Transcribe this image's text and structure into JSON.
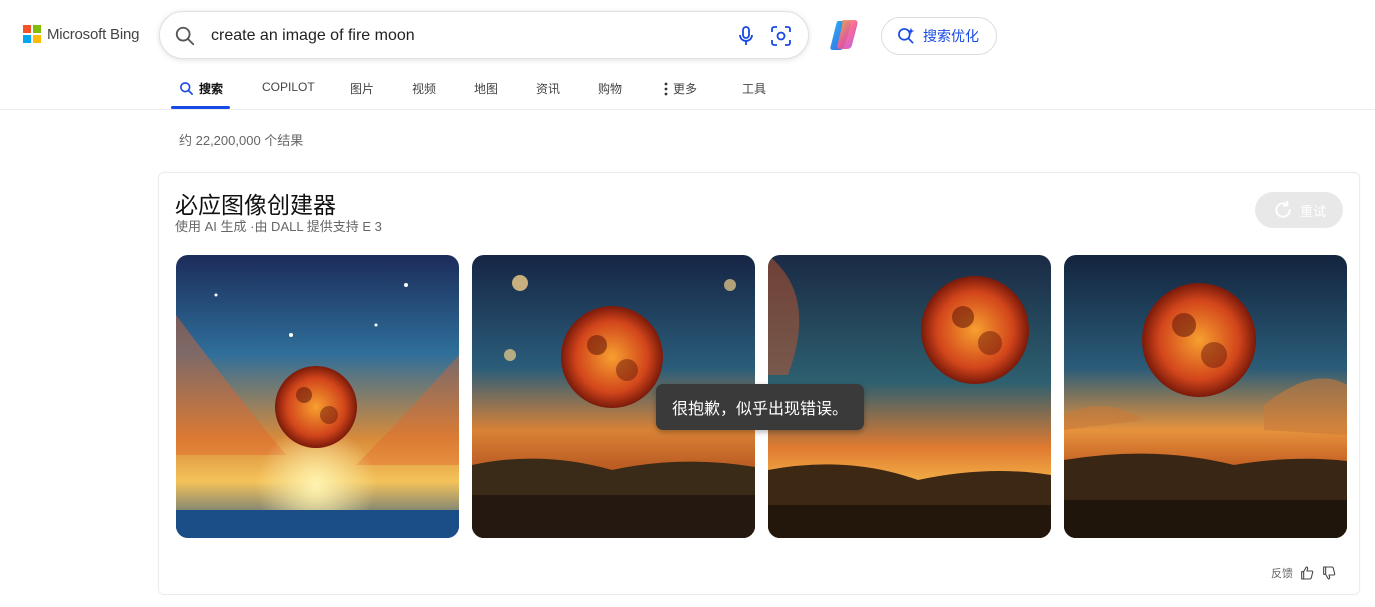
{
  "header": {
    "logo_text": "Microsoft Bing",
    "search": {
      "value": "create an image of fire moon"
    },
    "optimize_label": "搜索优化"
  },
  "nav": {
    "items": [
      {
        "label": "搜索",
        "active": true,
        "icon": "search-icon"
      },
      {
        "label": "COPILOT"
      },
      {
        "label": "图片"
      },
      {
        "label": "视频"
      },
      {
        "label": "地图"
      },
      {
        "label": "资讯"
      },
      {
        "label": "购物"
      },
      {
        "label": "更多",
        "icon": "more-vertical-icon"
      },
      {
        "label": "工具"
      }
    ]
  },
  "result_count": "约 22,200,000 个结果",
  "card": {
    "title": "必应图像创建器",
    "subtitle": "使用 AI 生成 ·由 DALL 提供支持 E 3",
    "retry_label": "重试",
    "images": [
      {
        "alt": "fire moon image 1"
      },
      {
        "alt": "fire moon image 2"
      },
      {
        "alt": "fire moon image 3"
      },
      {
        "alt": "fire moon image 4"
      }
    ],
    "error_toast": "很抱歉，似乎出现错误。",
    "feedback_label": "反馈"
  },
  "colors": {
    "accent": "#174ae4",
    "moon_fire": "#e8651a",
    "toast_bg": "#3a3a3a"
  }
}
